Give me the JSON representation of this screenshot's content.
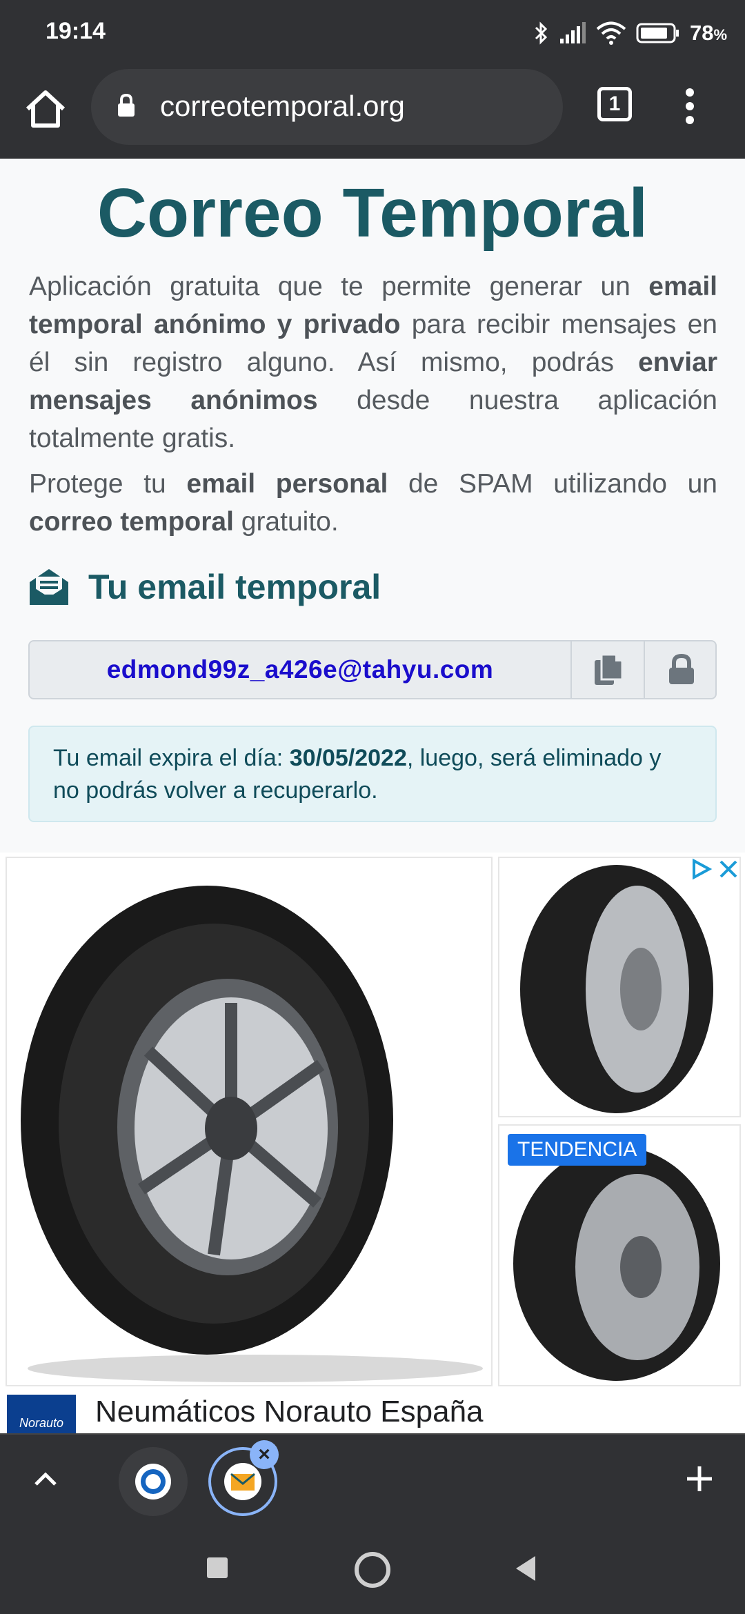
{
  "status_bar": {
    "time": "19:14",
    "battery": "78"
  },
  "browser": {
    "url": "correotemporal.org",
    "tab_count": "1"
  },
  "page": {
    "title": "Correo Temporal",
    "intro": {
      "p1": "Aplicación gratuita que te permite generar un ",
      "b1": "email temporal anónimo y privado",
      "p2": " para recibir mensajes en él sin registro alguno. Así mismo, podrás ",
      "b2": "enviar mensajes anónimos",
      "p3": " desde nuestra aplicación totalmente gratis."
    },
    "protect": {
      "p1": "Protege tu ",
      "b1": "email personal",
      "p2": " de SPAM utilizando un ",
      "b2": "correo temporal",
      "p3": " gratuito."
    },
    "section_title": "Tu email temporal",
    "email": "edmond99z_a426e@tahyu.com",
    "expiry": {
      "p1": "Tu email expira el día: ",
      "date": "30/05/2022",
      "p2": ", luego, será eliminado y no podrás volver a recuperarlo."
    }
  },
  "ad": {
    "badge": "TENDENCIA",
    "logo_text": "Norauto",
    "headline": "Neumáticos Norauto España"
  },
  "colors": {
    "title": "#1b5a64",
    "email": "#1a0dcc",
    "chrome": "#303134",
    "accent": "#1a73e8"
  }
}
